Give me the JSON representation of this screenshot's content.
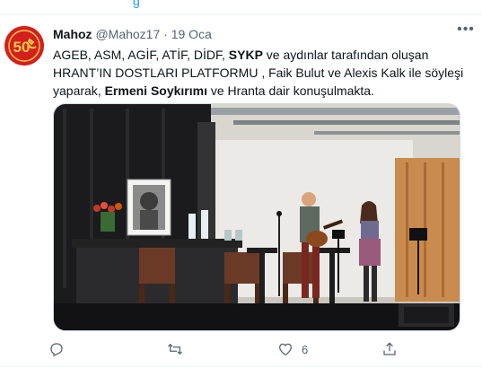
{
  "previous_tweet": {
    "link_partial": "g"
  },
  "tweet": {
    "author_name": "Mahoz",
    "author_handle": "@Mahoz17",
    "separator": "·",
    "date": "19 Oca",
    "avatar_text": "50",
    "text_parts": [
      {
        "text": "AGEB, ASM, AGİF, ATİF, DİDF, ",
        "bold": false
      },
      {
        "text": "SYKP",
        "bold": true
      },
      {
        "text": " ve aydınlar tarafından  oluşan HRANT’IN DOSTLARI PLATFORMU , Faik Bulut ve Alexis Kalk ile söyleşi yaparak, ",
        "bold": false
      },
      {
        "text": "Ermeni Soykırımı",
        "bold": true
      },
      {
        "text": " ve Hranta dair konuşulmakta.",
        "bold": false
      }
    ],
    "media": {
      "type": "photo",
      "description_icon": "event-photo"
    },
    "actions": {
      "reply_count": "",
      "retweet_count": "",
      "like_count": "6",
      "share_count": ""
    }
  },
  "colors": {
    "text_primary": "#0f1419",
    "text_secondary": "#536471",
    "link": "#1d9bf0",
    "avatar_bg": "#d41f1f",
    "divider": "#eff3f4"
  }
}
